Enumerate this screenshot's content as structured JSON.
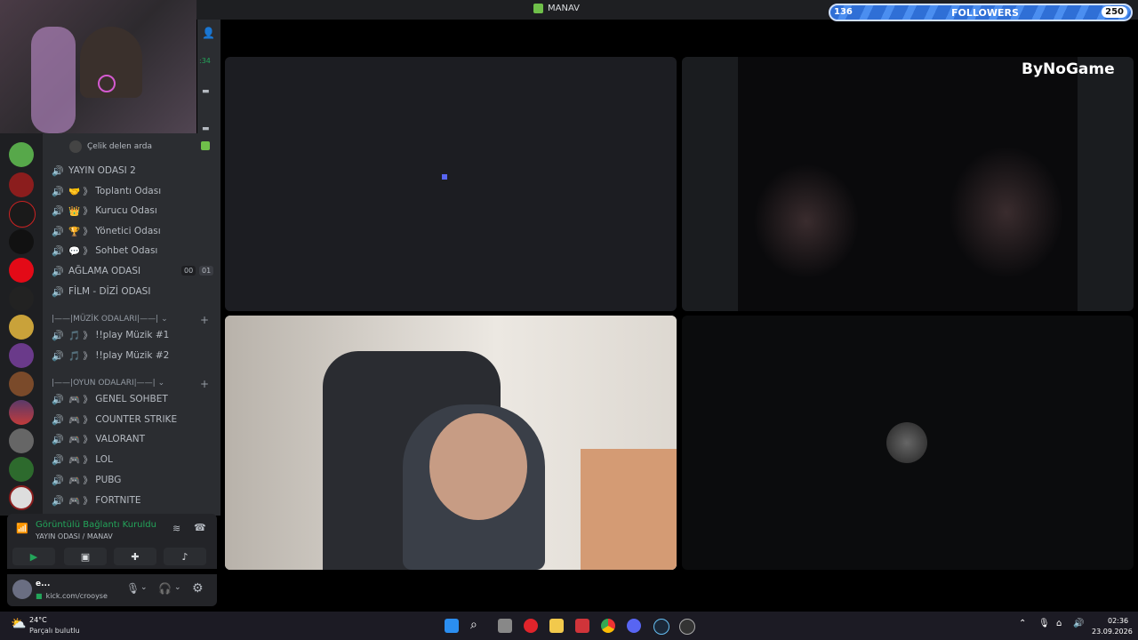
{
  "window": {
    "title": "MANAV"
  },
  "followers": {
    "current": "136",
    "label": "FOLLOWERS",
    "goal": "250",
    "progress": 0.544
  },
  "brand": {
    "watermark": "ByNoGame"
  },
  "sidebar": {
    "top_channel_user": "Çelik delen arda",
    "side_count": ":34",
    "channels": [
      {
        "label": "YAYIN ODASI 2",
        "emoji": ""
      },
      {
        "label": "Toplantı Odası",
        "emoji": "🤝 》"
      },
      {
        "label": "Kurucu Odası",
        "emoji": "👑 》"
      },
      {
        "label": "Yönetici Odası",
        "emoji": "🏆 》"
      },
      {
        "label": "Sohbet Odası",
        "emoji": "💬 》"
      },
      {
        "label": "AĞLAMA ODASI",
        "emoji": "",
        "badge_a": "00",
        "badge_b": "01"
      },
      {
        "label": "FİLM - DİZİ ODASI",
        "emoji": ""
      }
    ],
    "category_music": "|——|MÜZİK ODALARI|——|",
    "music_channels": [
      {
        "label": "!!play Müzik #1",
        "emoji": "🎵 》"
      },
      {
        "label": "!!play Müzik #2",
        "emoji": "🎵 》"
      }
    ],
    "category_games": "|——|OYUN ODALARI|——|",
    "game_channels": [
      {
        "label": "GENEL SOHBET",
        "emoji": "🎮 》"
      },
      {
        "label": "COUNTER STRIKE",
        "emoji": "🎮 》"
      },
      {
        "label": "VALORANT",
        "emoji": "🎮 》"
      },
      {
        "label": "LOL",
        "emoji": "🎮 》"
      },
      {
        "label": "PUBG",
        "emoji": "🎮 》"
      },
      {
        "label": "FORTNITE",
        "emoji": "🎮 》"
      }
    ]
  },
  "voice": {
    "status": "Görüntülü Bağlantı Kuruldu",
    "location": "YAYIN ODASI / MANAV"
  },
  "user": {
    "name": "e...",
    "status": "kick.com/crooyse"
  },
  "taskbar": {
    "weather_temp": "24°C",
    "weather_desc": "Parçalı bulutlu",
    "time": "02:36",
    "date": "23.09.2026"
  },
  "colors": {
    "accent": "#5865f2",
    "connected": "#23a55a",
    "followers_bar": "#2f6fd6"
  }
}
